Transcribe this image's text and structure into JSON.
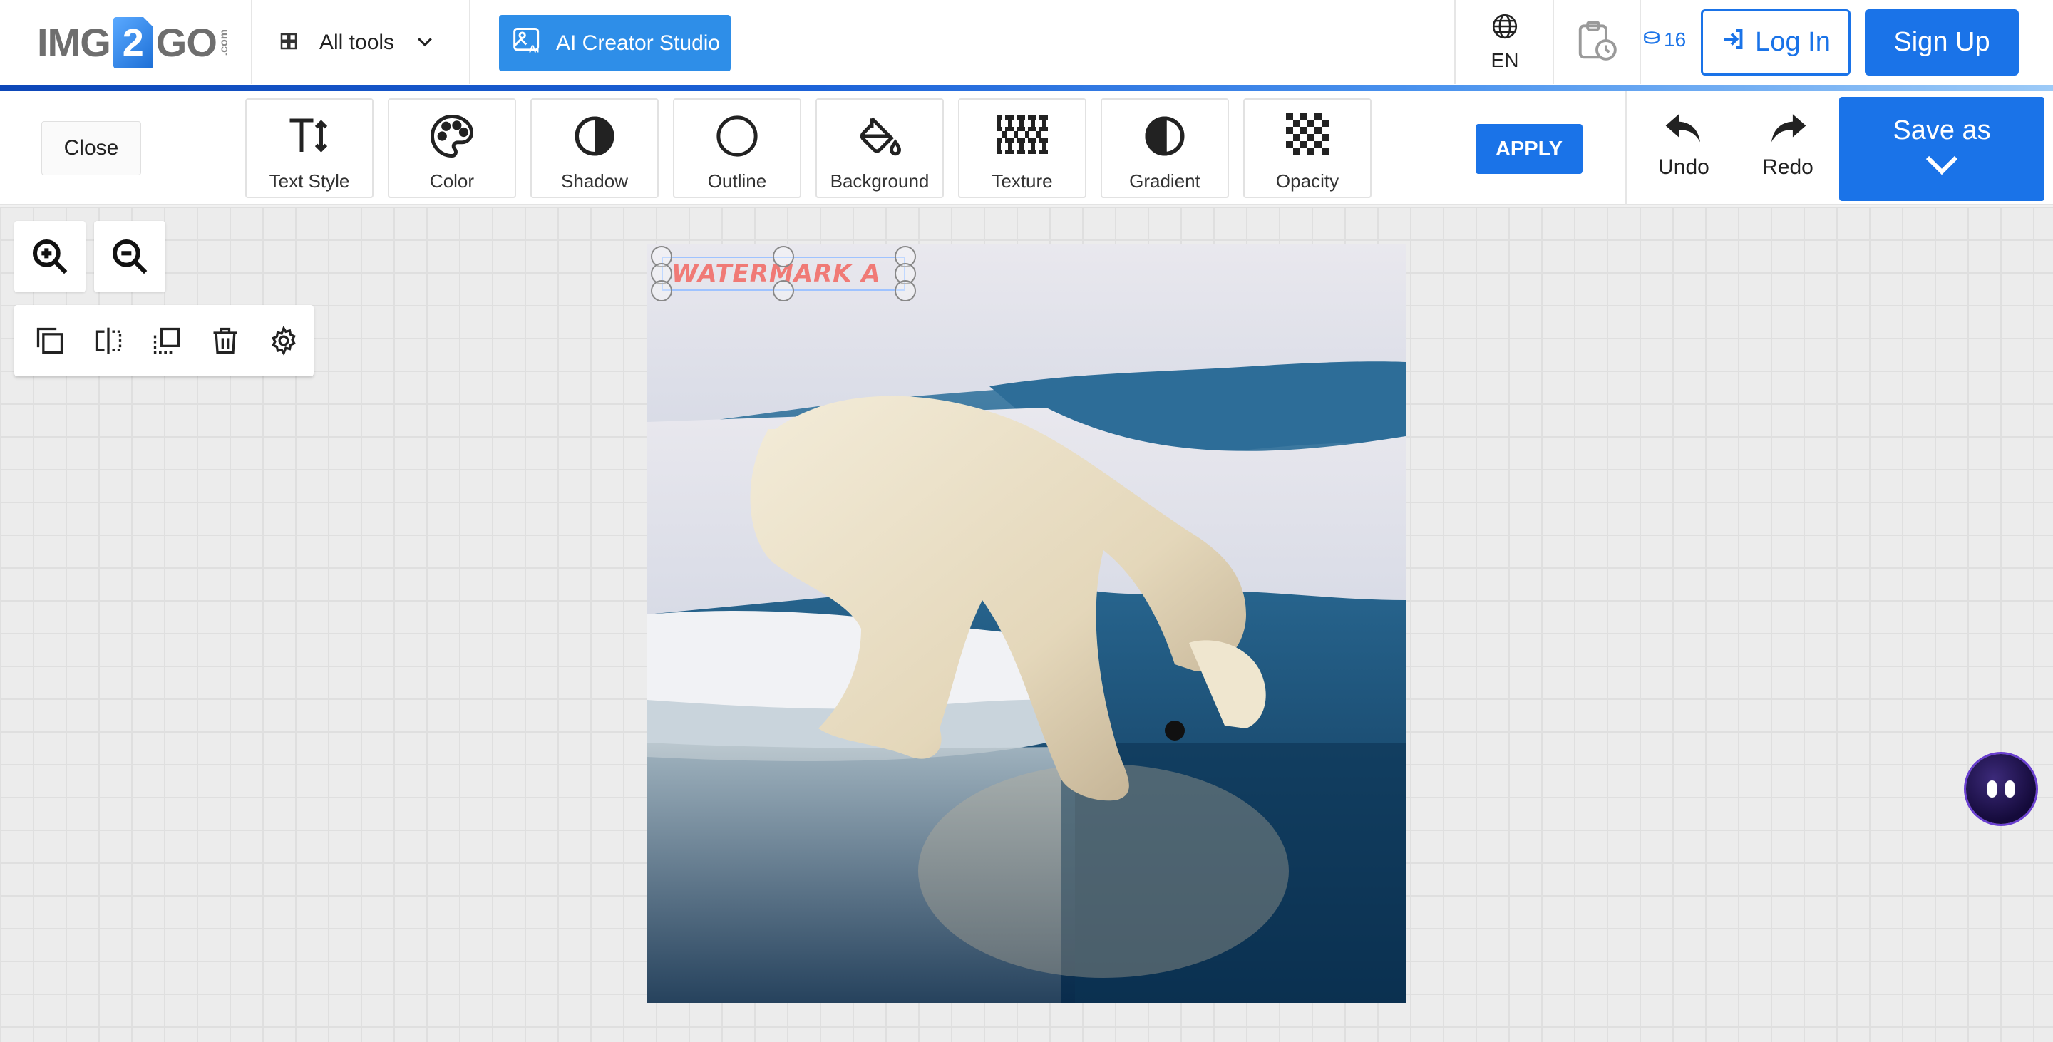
{
  "header": {
    "logo": {
      "left": "IMG",
      "mid": "2",
      "right": "GO",
      "suffix": ".com"
    },
    "all_tools_label": "All tools",
    "ai_button_label": "AI Creator Studio",
    "language": "EN",
    "credits": "16",
    "login_label": "Log In",
    "signup_label": "Sign Up",
    "accent_color": "#1a73e8"
  },
  "toolbar": {
    "close_label": "Close",
    "tools": [
      {
        "label": "Text Style",
        "icon": "text-style-icon"
      },
      {
        "label": "Color",
        "icon": "palette-icon"
      },
      {
        "label": "Shadow",
        "icon": "shadow-icon"
      },
      {
        "label": "Outline",
        "icon": "outline-circle-icon"
      },
      {
        "label": "Background",
        "icon": "paint-bucket-icon"
      },
      {
        "label": "Texture",
        "icon": "texture-icon"
      },
      {
        "label": "Gradient",
        "icon": "gradient-icon"
      },
      {
        "label": "Opacity",
        "icon": "checkerboard-icon"
      }
    ],
    "apply_label": "APPLY",
    "undo_label": "Undo",
    "redo_label": "Redo",
    "save_as_label": "Save as"
  },
  "canvas": {
    "watermark_text": "WATERMARK A"
  }
}
